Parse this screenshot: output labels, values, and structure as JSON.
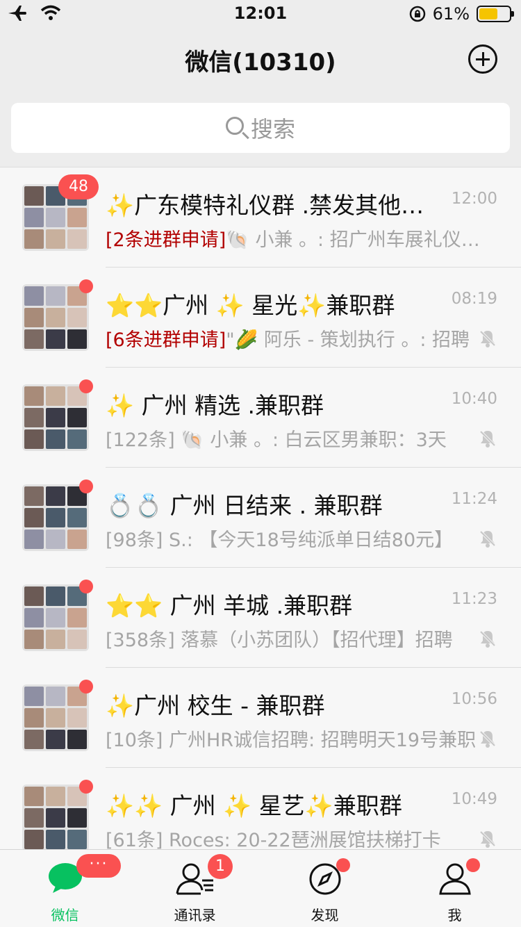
{
  "status_bar": {
    "time": "12:01",
    "battery": "61%"
  },
  "nav": {
    "title": "微信(10310)"
  },
  "search": {
    "placeholder": "搜索"
  },
  "chats": [
    {
      "title": "✨广东模特礼仪群 .禁发其他广告",
      "time": "12:00",
      "preview_prefix": "[2条进群申请]",
      "preview": "🐚 小兼 。: 招广州车展礼仪模特",
      "badge": "48",
      "muted": false
    },
    {
      "title": "⭐⭐广州 ✨ 星光✨兼职群",
      "time": "08:19",
      "preview_prefix": "[6条进群申请]",
      "preview": "\"🌽 阿乐 - 策划执行 。: 招聘",
      "badge": "",
      "muted": true
    },
    {
      "title": "✨ 广州 精选 .兼职群",
      "time": "10:40",
      "preview_prefix": "",
      "preview": "[122条] 🐚 小兼 。: 白云区男兼职：3天",
      "badge": "",
      "muted": true
    },
    {
      "title": "💍💍 广州 日结来 . 兼职群",
      "time": "11:24",
      "preview_prefix": "",
      "preview": "[98条] S.: 【今天18号纯派单日结80元】",
      "badge": "",
      "muted": true
    },
    {
      "title": "⭐⭐ 广州 羊城 .兼职群",
      "time": "11:23",
      "preview_prefix": "",
      "preview": "[358条] 落慕（小苏团队）【招代理】招聘",
      "badge": "",
      "muted": true
    },
    {
      "title": "✨广州 校生 - 兼职群",
      "time": "10:56",
      "preview_prefix": "",
      "preview": "[10条] 广州HR诚信招聘: 招聘明天19号兼职",
      "badge": "",
      "muted": true
    },
    {
      "title": "✨✨ 广州 ✨ 星艺✨兼职群",
      "time": "10:49",
      "preview_prefix": "",
      "preview": "[61条] Roces: 20-22琶洲展馆扶梯打卡",
      "badge": "",
      "muted": true
    }
  ],
  "tabs": [
    {
      "label": "微信",
      "badge": "···",
      "active": true
    },
    {
      "label": "通讯录",
      "badge": "1",
      "active": false
    },
    {
      "label": "发现",
      "badge": "",
      "active": false
    },
    {
      "label": "我",
      "badge": "",
      "active": false
    }
  ],
  "colors": {
    "accent": "#07c160",
    "badge": "#fa5151",
    "request_text": "#b20000",
    "battery": "#f5c400"
  }
}
